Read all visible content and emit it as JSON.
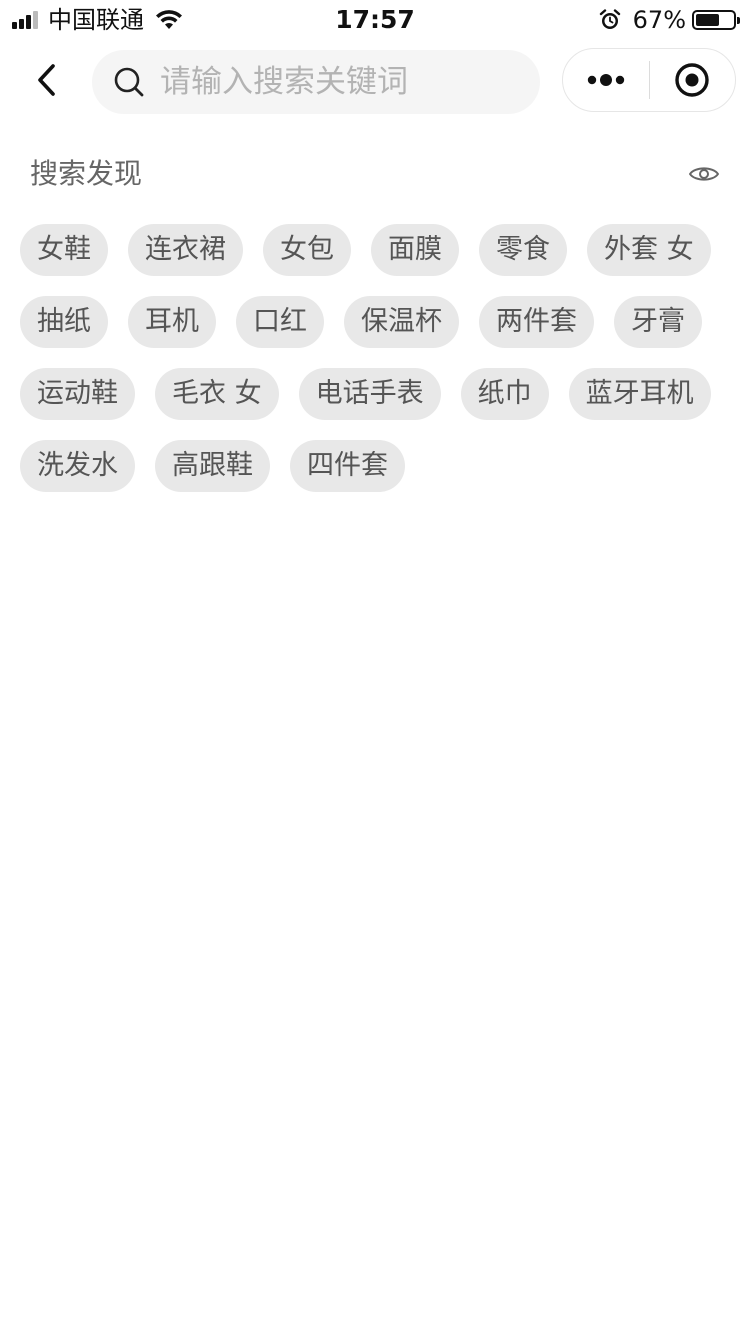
{
  "status_bar": {
    "carrier": "中国联通",
    "time": "17:57",
    "battery_percent": "67%",
    "battery_level": 0.67,
    "icons": [
      "signal-icon",
      "wifi-icon",
      "alarm-icon",
      "battery-icon"
    ]
  },
  "nav": {
    "back_icon": "chevron-left-icon",
    "search": {
      "placeholder": "请输入搜索关键词",
      "value": "",
      "icon": "search-icon"
    },
    "capsule": {
      "more_icon": "more-dots-icon",
      "close_icon": "target-circle-icon"
    }
  },
  "discover": {
    "title": "搜索发现",
    "toggle_icon": "eye-icon",
    "rows": [
      [
        "女鞋",
        "连衣裙",
        "女包",
        "面膜",
        "零食",
        "外套 女"
      ],
      [
        "抽纸",
        "耳机",
        "口红",
        "保温杯",
        "两件套",
        "牙膏"
      ],
      [
        "运动鞋",
        "毛衣 女",
        "电话手表",
        "纸巾",
        "蓝牙耳机"
      ],
      [
        "洗发水",
        "高跟鞋",
        "四件套"
      ]
    ]
  },
  "colors": {
    "tag_background": "#e8e8e8",
    "tag_text": "#555555",
    "search_background": "#f5f5f5",
    "placeholder": "#b3b3b3"
  }
}
